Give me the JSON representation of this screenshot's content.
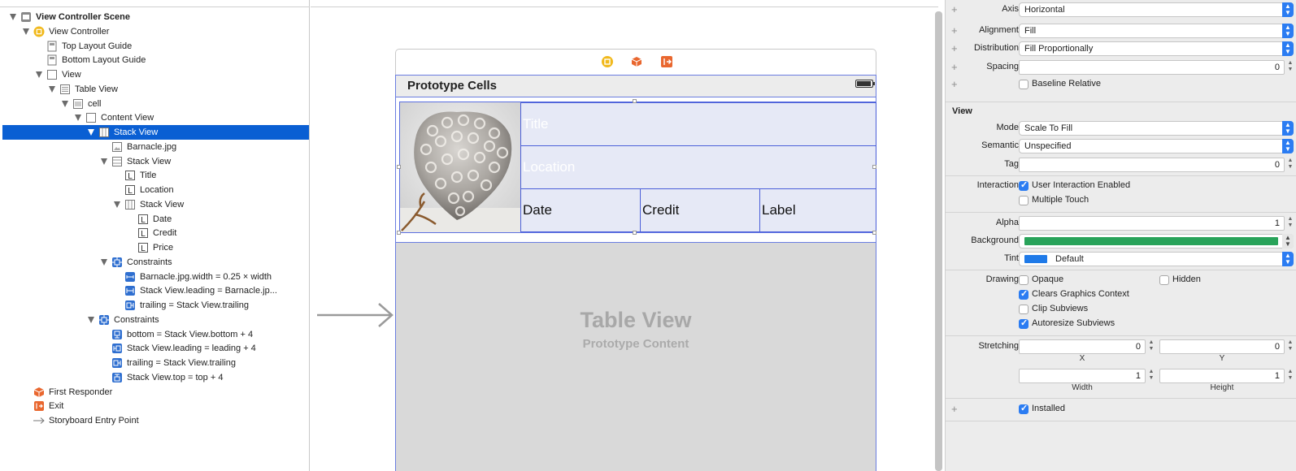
{
  "outline": {
    "items": [
      {
        "label": "View Controller Scene",
        "indent": 0,
        "icon": "scene-icon",
        "expanded": true,
        "bold": true
      },
      {
        "label": "View Controller",
        "indent": 1,
        "icon": "view-controller-icon",
        "expanded": true
      },
      {
        "label": "Top Layout Guide",
        "indent": 2,
        "icon": "layout-guide-icon"
      },
      {
        "label": "Bottom Layout Guide",
        "indent": 2,
        "icon": "layout-guide-icon"
      },
      {
        "label": "View",
        "indent": 2,
        "icon": "view-icon",
        "expanded": true
      },
      {
        "label": "Table View",
        "indent": 3,
        "icon": "table-view-icon",
        "expanded": true
      },
      {
        "label": "cell",
        "indent": 4,
        "icon": "cell-icon",
        "expanded": true
      },
      {
        "label": "Content View",
        "indent": 5,
        "icon": "view-icon",
        "expanded": true
      },
      {
        "label": "Stack View",
        "indent": 6,
        "icon": "stack-view-icon",
        "expanded": true,
        "selected": true
      },
      {
        "label": "Barnacle.jpg",
        "indent": 7,
        "icon": "image-view-icon"
      },
      {
        "label": "Stack View",
        "indent": 7,
        "icon": "vertical-stack-icon",
        "expanded": true
      },
      {
        "label": "Title",
        "indent": 8,
        "icon": "label-icon"
      },
      {
        "label": "Location",
        "indent": 8,
        "icon": "label-icon"
      },
      {
        "label": "Stack View",
        "indent": 8,
        "icon": "stack-view-icon",
        "expanded": true
      },
      {
        "label": "Date",
        "indent": 9,
        "icon": "label-icon"
      },
      {
        "label": "Credit",
        "indent": 9,
        "icon": "label-icon"
      },
      {
        "label": "Price",
        "indent": 9,
        "icon": "label-icon"
      },
      {
        "label": "Constraints",
        "indent": 7,
        "icon": "constraints-icon",
        "expanded": true
      },
      {
        "label": "Barnacle.jpg.width = 0.25 × width",
        "indent": 8,
        "icon": "constraint-width-icon"
      },
      {
        "label": "Stack View.leading = Barnacle.jp...",
        "indent": 8,
        "icon": "constraint-h-icon"
      },
      {
        "label": "trailing = Stack View.trailing",
        "indent": 8,
        "icon": "constraint-trailing-icon"
      },
      {
        "label": "Constraints",
        "indent": 6,
        "icon": "constraints-icon",
        "expanded": true
      },
      {
        "label": "bottom = Stack View.bottom + 4",
        "indent": 7,
        "icon": "constraint-bottom-icon"
      },
      {
        "label": "Stack View.leading = leading + 4",
        "indent": 7,
        "icon": "constraint-leading-icon"
      },
      {
        "label": "trailing = Stack View.trailing",
        "indent": 7,
        "icon": "constraint-trailing-icon"
      },
      {
        "label": "Stack View.top = top + 4",
        "indent": 7,
        "icon": "constraint-top-icon"
      },
      {
        "label": "First Responder",
        "indent": 1,
        "icon": "first-responder-icon"
      },
      {
        "label": "Exit",
        "indent": 1,
        "icon": "exit-icon"
      },
      {
        "label": "Storyboard Entry Point",
        "indent": 1,
        "icon": "entry-arrow-icon"
      }
    ]
  },
  "canvas": {
    "header_title": "Prototype Cells",
    "labels": {
      "title": "Title",
      "location": "Location",
      "date": "Date",
      "credit": "Credit",
      "label": "Label"
    },
    "table_view_title": "Table View",
    "table_view_subtitle": "Prototype Content",
    "icons": [
      "view-controller-icon",
      "first-responder-icon",
      "exit-icon"
    ],
    "image_name": "Barnacle.jpg"
  },
  "inspector": {
    "stack": {
      "axis_label": "Axis",
      "axis_value": "Horizontal",
      "alignment_label": "Alignment",
      "alignment_value": "Fill",
      "distribution_label": "Distribution",
      "distribution_value": "Fill Proportionally",
      "spacing_label": "Spacing",
      "spacing_value": "0",
      "baseline_label": "Baseline Relative",
      "baseline_checked": false
    },
    "view": {
      "section_title": "View",
      "mode_label": "Mode",
      "mode_value": "Scale To Fill",
      "semantic_label": "Semantic",
      "semantic_value": "Unspecified",
      "tag_label": "Tag",
      "tag_value": "0",
      "interaction_label": "Interaction",
      "user_interaction_label": "User Interaction Enabled",
      "user_interaction_checked": true,
      "multiple_touch_label": "Multiple Touch",
      "multiple_touch_checked": false,
      "alpha_label": "Alpha",
      "alpha_value": "1",
      "background_label": "Background",
      "background_color": "#29a35a",
      "tint_label": "Tint",
      "tint_value": "Default",
      "tint_color": "#1f7ae8",
      "drawing_label": "Drawing",
      "opaque_label": "Opaque",
      "opaque_checked": false,
      "hidden_label": "Hidden",
      "hidden_checked": false,
      "clears_label": "Clears Graphics Context",
      "clears_checked": true,
      "clip_label": "Clip Subviews",
      "clip_checked": false,
      "autoresize_label": "Autoresize Subviews",
      "autoresize_checked": true,
      "stretching_label": "Stretching",
      "stretch_x": "0",
      "stretch_y": "0",
      "x_label": "X",
      "y_label": "Y",
      "stretch_w": "1",
      "stretch_h": "1",
      "width_label": "Width",
      "height_label": "Height",
      "installed_label": "Installed",
      "installed_checked": true
    }
  },
  "colors": {
    "selection": "#0a5fd3",
    "outline_blue": "#4b5fd9",
    "accent": "#2b7cf2"
  }
}
